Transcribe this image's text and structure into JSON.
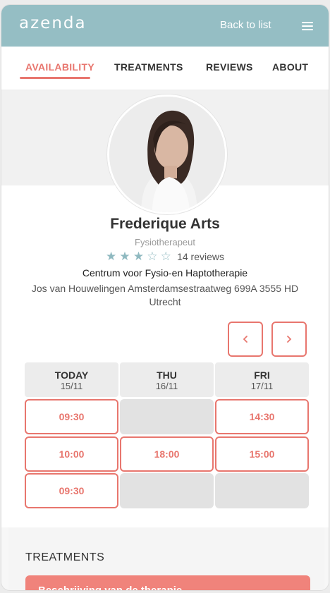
{
  "header": {
    "logo": "azenda",
    "back_link": "Back to list",
    "menu_icon": "hamburger-menu-icon"
  },
  "tabs": [
    {
      "label": "AVAILABILITY",
      "active": true
    },
    {
      "label": "TREATMENTS",
      "active": false
    },
    {
      "label": "REVIEWS",
      "active": false
    },
    {
      "label": "ABOUT",
      "active": false
    }
  ],
  "profile": {
    "name": "Frederique Arts",
    "profession": "Fysiotherapeut",
    "rating": 3,
    "rating_max": 5,
    "reviews": "14 reviews",
    "practice": "Centrum voor Fysio-en Haptotherapie",
    "address": "Jos van Houwelingen Amsterdamsestraatweg 699A 3555 HD Utrecht"
  },
  "calendar": {
    "prev_icon": "chevron-left-icon",
    "next_icon": "chevron-right-icon",
    "days": [
      {
        "name": "TODAY",
        "date": "15/11"
      },
      {
        "name": "THU",
        "date": "16/11"
      },
      {
        "name": "FRI",
        "date": "17/11"
      }
    ],
    "slots": [
      [
        "09:30",
        "",
        "14:30"
      ],
      [
        "10:00",
        "18:00",
        "15:00"
      ],
      [
        "09:30",
        "",
        ""
      ]
    ]
  },
  "treatments": {
    "title": "TREATMENTS",
    "first_item": "Beschrijving van de therapie"
  },
  "colors": {
    "header_bg": "#95bec4",
    "accent": "#e8766e",
    "star": "#8fb9c0",
    "treatment_btn": "#f0837b"
  }
}
